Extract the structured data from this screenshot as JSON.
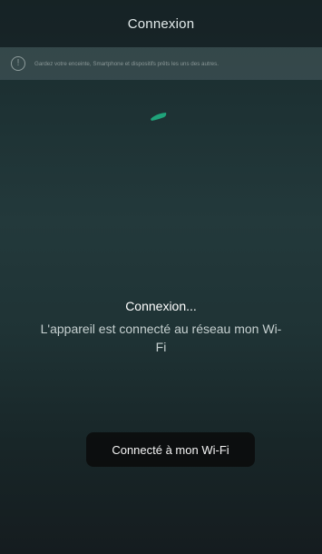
{
  "header": {
    "title": "Connexion"
  },
  "notice": {
    "icon": "info-icon",
    "text": "Gardez votre enceinte, Smartphone et dispositifs prêts les uns des autres."
  },
  "progress": {
    "icon": "loading-spinner-icon",
    "accent_color": "#1fa37a"
  },
  "status": {
    "title": "Connexion...",
    "message": "L'appareil est connecté au réseau mon Wi-Fi"
  },
  "toast": {
    "text": "Connecté à mon Wi-Fi"
  }
}
